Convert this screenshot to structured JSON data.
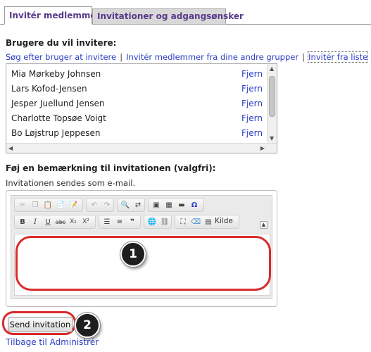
{
  "tabs": [
    {
      "label": "Invitér medlemmer"
    },
    {
      "label": "Invitationer og adgangsønsker"
    }
  ],
  "invite": {
    "heading": "Brugere du vil invitere:",
    "links": [
      "Søg efter bruger at invitere",
      "Invitér medlemmer fra dine andre grupper",
      "Invitér fra liste"
    ],
    "separator": "|",
    "users": [
      {
        "name": "Mia Mørkeby Johnsen",
        "action": "Fjern"
      },
      {
        "name": "Lars Kofod-Jensen",
        "action": "Fjern"
      },
      {
        "name": "Jesper Juellund Jensen",
        "action": "Fjern"
      },
      {
        "name": "Charlotte Topsøe Voigt",
        "action": "Fjern"
      },
      {
        "name": "Bo Løjstrup Jeppesen",
        "action": "Fjern"
      }
    ]
  },
  "note": {
    "heading": "Føj en bemærkning til invitationen (valgfri):",
    "info": "Invitationen sendes som e-mail."
  },
  "editor": {
    "source_label": "Kilde",
    "toolbar_row1_icons": [
      "cut-icon",
      "copy-icon",
      "paste-icon",
      "paste-text-icon",
      "paste-word-icon",
      "undo-icon",
      "redo-icon",
      "find-icon",
      "replace-icon",
      "image-icon",
      "table-icon",
      "horizontal-rule-icon",
      "special-char-icon"
    ],
    "toolbar_row2_icons": [
      "bold-icon",
      "italic-icon",
      "underline-icon",
      "strike-icon",
      "subscript-icon",
      "superscript-icon",
      "numbered-list-icon",
      "bullet-list-icon",
      "blockquote-icon",
      "link-icon",
      "unlink-icon",
      "maximize-icon",
      "remove-format-icon",
      "source-icon"
    ]
  },
  "callouts": {
    "one": "1",
    "two": "2"
  },
  "actions": {
    "send_label": "Send invitation",
    "back_link": "Tilbage til Administrér"
  },
  "colors": {
    "accent_link": "#2a3cc5",
    "tab_text": "#5a3a8a",
    "callout_ring": "#d92b2b"
  }
}
